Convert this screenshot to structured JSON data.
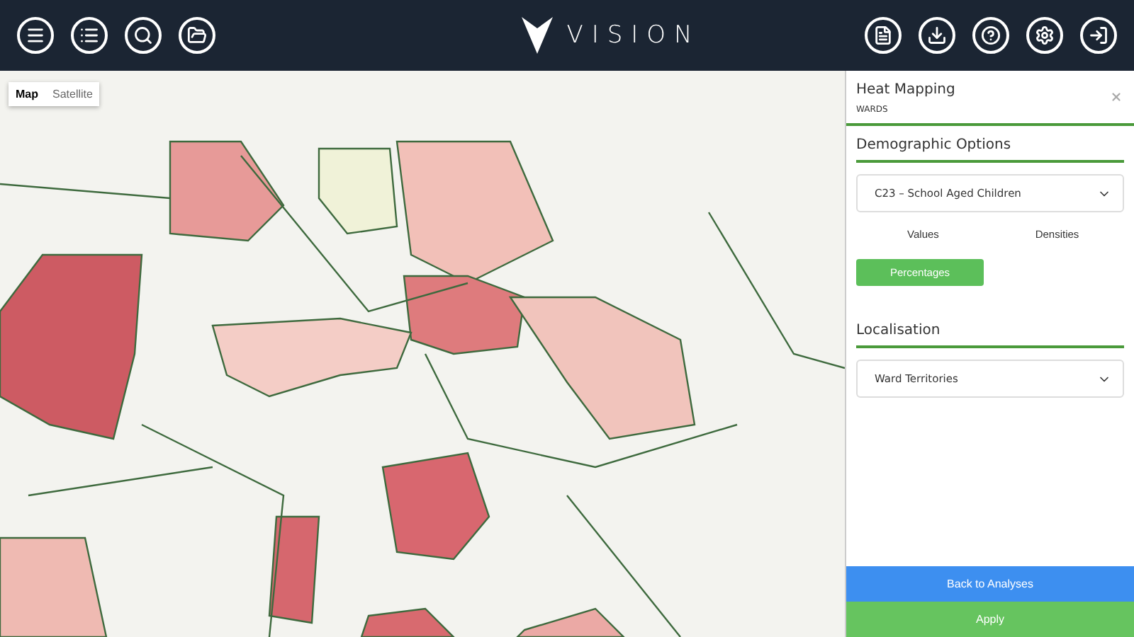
{
  "header": {
    "left_buttons": [
      {
        "kind": "menu"
      },
      {
        "kind": "list"
      },
      {
        "kind": "search"
      },
      {
        "kind": "folder"
      }
    ],
    "logo": "VISION",
    "right_buttons": [
      {
        "kind": "report"
      },
      {
        "kind": "download"
      },
      {
        "kind": "help"
      },
      {
        "kind": "settings"
      },
      {
        "kind": "exit"
      }
    ]
  },
  "map": {
    "type_tabs": [
      {
        "label": "Map",
        "selected": true
      },
      {
        "label": "Satellite",
        "selected": false
      }
    ]
  },
  "panel": {
    "title": "Heat Mapping",
    "subtitle": "WARDS",
    "sections": [
      {
        "heading": "Demographic Options",
        "select": "C23 – School Aged Children",
        "options": [
          {
            "label": "Values",
            "selected": false
          },
          {
            "label": "Densities",
            "selected": false
          },
          {
            "label": "Percentages",
            "selected": true
          }
        ]
      },
      {
        "heading": "Localisation",
        "select": "Ward Territories"
      }
    ],
    "buttons": [
      {
        "kind": "secondary",
        "label": "Back to Analyses"
      },
      {
        "kind": "primary",
        "label": "Apply"
      }
    ]
  }
}
